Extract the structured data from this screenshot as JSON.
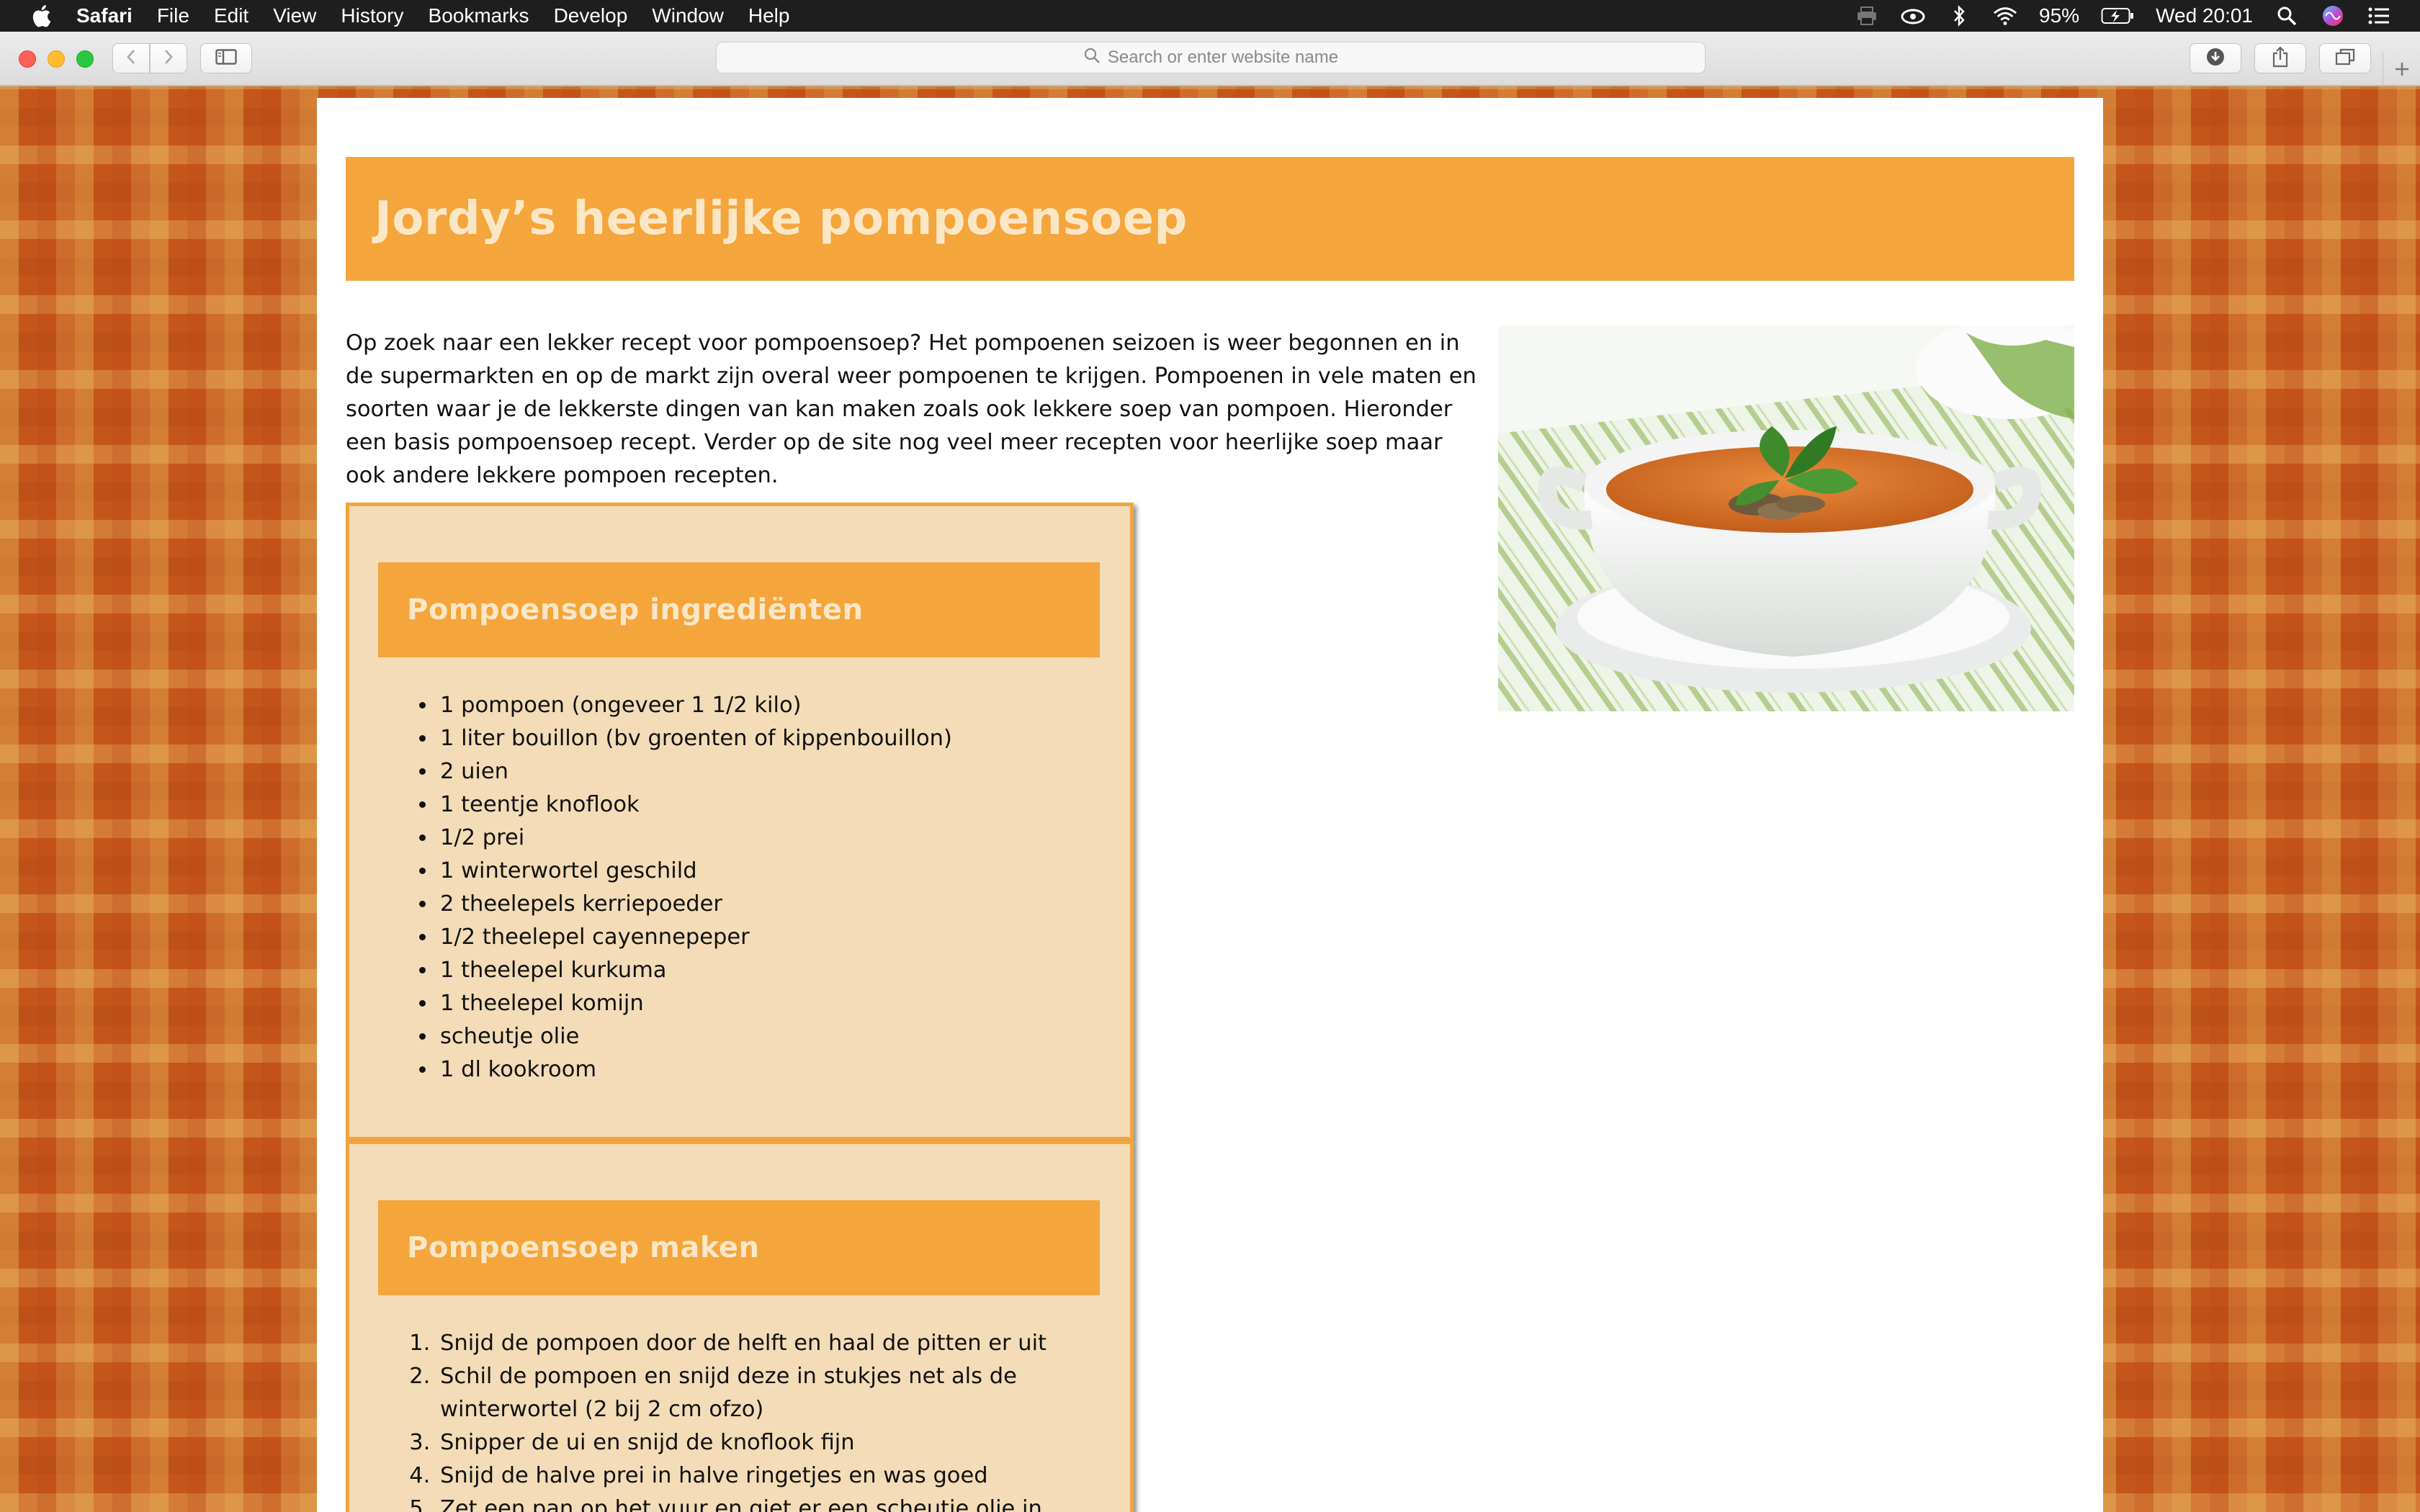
{
  "menubar": {
    "app_name": "Safari",
    "items": [
      "File",
      "Edit",
      "View",
      "History",
      "Bookmarks",
      "Develop",
      "Window",
      "Help"
    ],
    "battery": "95%",
    "clock": "Wed 20:01"
  },
  "toolbar": {
    "address_placeholder": "Search or enter website name"
  },
  "page": {
    "title": "Jordy’s heerlijke pompoensoep",
    "intro": "Op zoek naar een lekker recept voor pompoensoep? Het pompoenen seizoen is weer begonnen en in de supermarkten en op de markt zijn overal weer pompoenen te krijgen. Pompoenen in vele maten en soorten waar je de lekkerste dingen van kan maken zoals ook lekkere soep van pompoen. Hieronder een basis pompoensoep recept. Verder op de site nog veel meer recepten voor heerlijke soep maar ook andere lekkere pompoen recepten.",
    "ingredients": {
      "title": "Pompoensoep ingrediënten",
      "items": [
        "1 pompoen (ongeveer 1 1/2 kilo)",
        "1 liter bouillon (bv groenten of kippenbouillon)",
        "2 uien",
        "1 teentje knoflook",
        "1/2 prei",
        "1 winterwortel geschild",
        "2 theelepels kerriepoeder",
        "1/2 theelepel cayennepeper",
        "1 theelepel kurkuma",
        "1 theelepel komijn",
        "scheutje olie",
        "1 dl kookroom"
      ]
    },
    "steps": {
      "title": "Pompoensoep maken",
      "items": [
        "Snijd de pompoen door de helft en haal de pitten er uit",
        "Schil de pompoen en snijd deze in stukjes net als de winterwortel (2 bij 2 cm ofzo)",
        "Snipper de ui en snijd de knoflook fijn",
        "Snijd de halve prei in halve ringetjes en was goed",
        "Zet een pan op het vuur en giet er een scheutje olie in"
      ]
    }
  },
  "colors": {
    "accent": "#f4a53b",
    "box_bg": "#f3dcb7",
    "header_text": "#fbe7c6"
  }
}
